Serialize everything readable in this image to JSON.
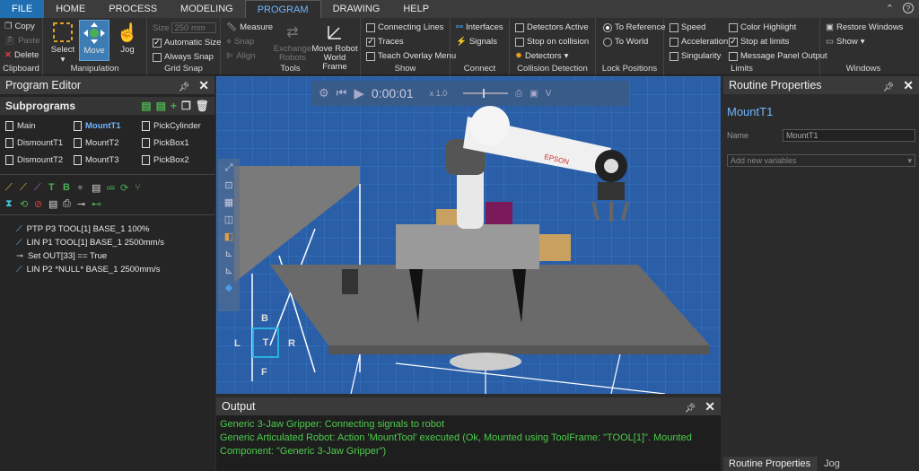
{
  "menu": {
    "tabs": [
      "FILE",
      "HOME",
      "PROCESS",
      "MODELING",
      "PROGRAM",
      "DRAWING",
      "HELP"
    ]
  },
  "ribbon": {
    "clipboard": {
      "label": "Clipboard",
      "copy": "Copy",
      "paste": "Paste",
      "delete": "Delete"
    },
    "manipulation": {
      "label": "Manipulation",
      "select": "Select",
      "move": "Move",
      "jog": "Jog"
    },
    "grid_snap": {
      "label": "Grid Snap",
      "size_placeholder": "Size",
      "size_value": "250",
      "size_unit": "mm",
      "auto_size": "Automatic Size",
      "always_snap": "Always Snap"
    },
    "tools": {
      "label": "Tools",
      "measure": "Measure",
      "snap": "Snap",
      "align": "Align",
      "exchange": "Exchange Robots",
      "move_robot": "Move Robot World Frame"
    },
    "show": {
      "label": "Show",
      "connecting_lines": "Connecting Lines",
      "traces": "Traces",
      "teach_overlay": "Teach Overlay Menu"
    },
    "connect": {
      "label": "Connect",
      "interfaces": "Interfaces",
      "signals": "Signals"
    },
    "collision": {
      "label": "Collision Detection",
      "detectors_active": "Detectors Active",
      "stop_on_collision": "Stop on collision",
      "detectors": "Detectors"
    },
    "lock": {
      "label": "Lock Positions",
      "to_reference": "To Reference",
      "to_world": "To World"
    },
    "limits": {
      "label": "Limits",
      "speed": "Speed",
      "acceleration": "Acceleration",
      "singularity": "Singularity",
      "color_highlight": "Color Highlight",
      "stop_at_limits": "Stop at limits",
      "message_panel": "Message Panel Output"
    },
    "windows": {
      "label": "Windows",
      "restore": "Restore Windows",
      "show": "Show"
    }
  },
  "program_editor": {
    "title": "Program Editor",
    "subprograms_title": "Subprograms",
    "subprograms": [
      "Main",
      "MountT1",
      "PickCylinder",
      "DismountT1",
      "MountT2",
      "PickBox1",
      "DismountT2",
      "MountT3",
      "PickBox2"
    ],
    "statements": [
      "PTP P3 TOOL[1] BASE_1 100%",
      "LIN P1 TOOL[1] BASE_1 2500mm/s",
      "Set OUT[33] == True",
      "LIN P2 *NULL* BASE_1 2500mm/s"
    ]
  },
  "playback": {
    "time": "0:00:01",
    "speed": "x 1.0"
  },
  "viewcube": {
    "b": "B",
    "l": "L",
    "t": "T",
    "r": "R",
    "f": "F"
  },
  "robot_brand": "EPSON",
  "routine": {
    "title": "Routine Properties",
    "name_heading": "MountT1",
    "name_label": "Name",
    "name_value": "MountT1",
    "add_vars": "Add new variables"
  },
  "output": {
    "title": "Output",
    "lines": [
      "Generic 3-Jaw Gripper: Connecting signals to robot",
      "Generic Articulated Robot: Action 'MountTool' executed (Ok, Mounted using ToolFrame: \"TOOL[1]\". Mounted Component: \"Generic 3-Jaw Gripper\")"
    ]
  },
  "bottom_tabs": [
    "Routine Properties",
    "Jog"
  ],
  "colors": {
    "accent": "#6fb6ff",
    "file_tab": "#1f6fb2",
    "viewport_bg": "#2a5fa8",
    "output_text": "#4ccc4c"
  }
}
